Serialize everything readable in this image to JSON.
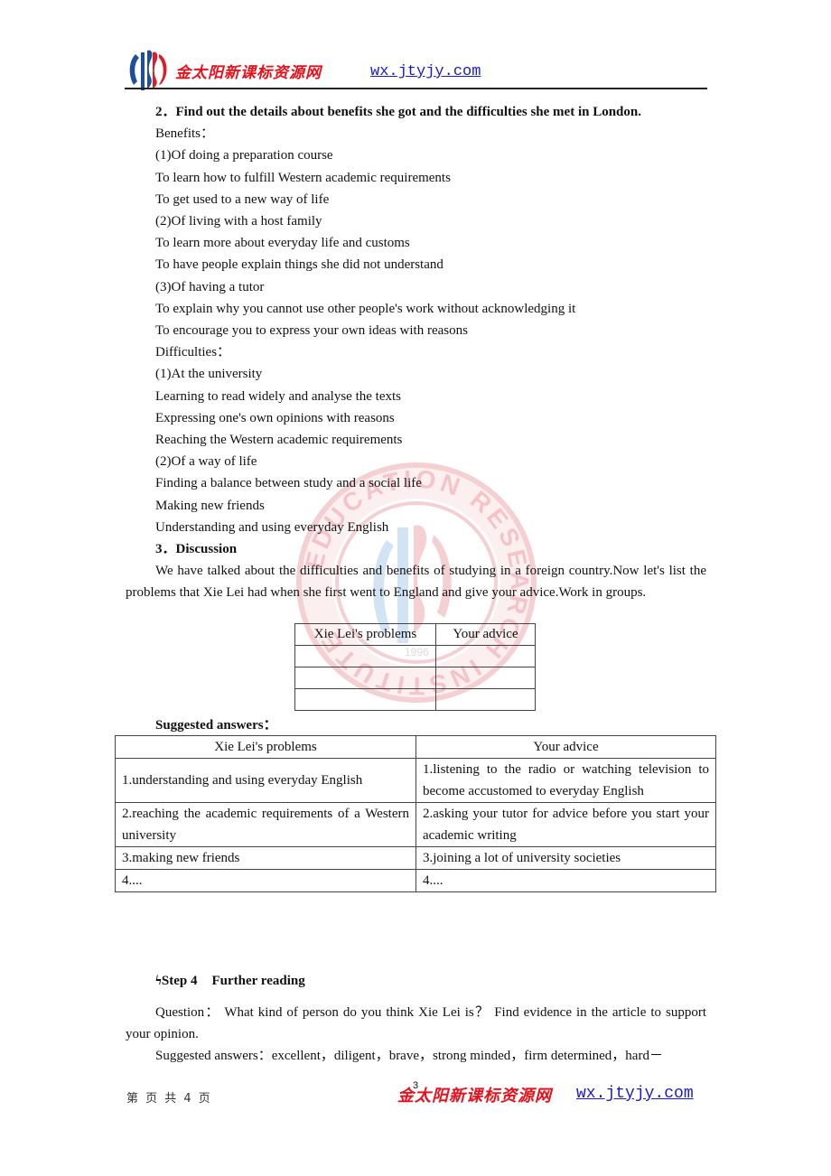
{
  "header": {
    "logo_icon": "jtyjy-logo-icon",
    "brand": "金太阳新课标资源网",
    "url": "wx.jtyjy.com"
  },
  "watermark": {
    "icon": "institute-seal-watermark-icon",
    "ring_text": "EDUCATION RESEARCH INSTITUTE",
    "year": "1996",
    "colors": {
      "ring": "#e57a82",
      "emblem": "#7fb2e0"
    }
  },
  "section2": {
    "heading_num": "2．",
    "heading_text": "Find out the details about benefits she got and the difficulties she met in London.",
    "benefits_label": "Benefits：",
    "benefits": [
      "(1)Of doing a preparation course",
      "To learn how to fulfill Western academic requirements",
      "To get used to a new way of life",
      "(2)Of living with a host family",
      "To learn more about everyday life and customs",
      "To have people explain things she did not understand",
      "(3)Of having a tutor",
      "To explain why you cannot use other people's work without acknowledging it",
      "To encourage you to express your own ideas with reasons"
    ],
    "difficulties_label": "Difficulties：",
    "difficulties": [
      "(1)At the university",
      "Learning to read widely and analyse the texts",
      "Expressing one's own opinions with reasons",
      "Reaching the Western academic requirements",
      "(2)Of a way of life",
      "Finding a balance between study and a social life",
      "Making new friends",
      "Understanding and using everyday English"
    ]
  },
  "section3": {
    "heading_num": "3．",
    "heading_text": "Discussion",
    "paragraph": "We have talked about the difficulties and benefits of studying in a foreign country.Now let's list the problems that Xie Lei had when she first went to England and give your advice.Work in groups.",
    "empty_table": {
      "headers": [
        "Xie Lei's problems",
        "Your advice"
      ],
      "rows": [
        [
          "",
          ""
        ],
        [
          "",
          ""
        ],
        [
          "",
          ""
        ]
      ]
    },
    "suggested_label": "Suggested answers：",
    "answer_table": {
      "headers": [
        "Xie Lei's problems",
        "Your advice"
      ],
      "rows": [
        [
          "1.understanding and using everyday English",
          "1.listening to the radio or watching television to become accustomed to everyday English"
        ],
        [
          "2.reaching the academic requirements of a Western university",
          "2.asking your tutor for advice before you start your academic writing"
        ],
        [
          "3.making new friends",
          "3.joining a lot of university societies"
        ],
        [
          "4....",
          "4...."
        ]
      ]
    }
  },
  "step4": {
    "marker": "ϟ",
    "label": "Step 4",
    "title": "Further reading",
    "question": "Question： What kind of person do you think Xie Lei is？ Find evidence in the article to support your opinion.",
    "answers": "Suggested answers：excellent，diligent，brave，strong minded，firm determined，hard－"
  },
  "footer": {
    "page_text": "第  页 共 4 页",
    "page_number": "3",
    "brand": "金太阳新课标资源网",
    "url": "wx.jtyjy.com"
  }
}
